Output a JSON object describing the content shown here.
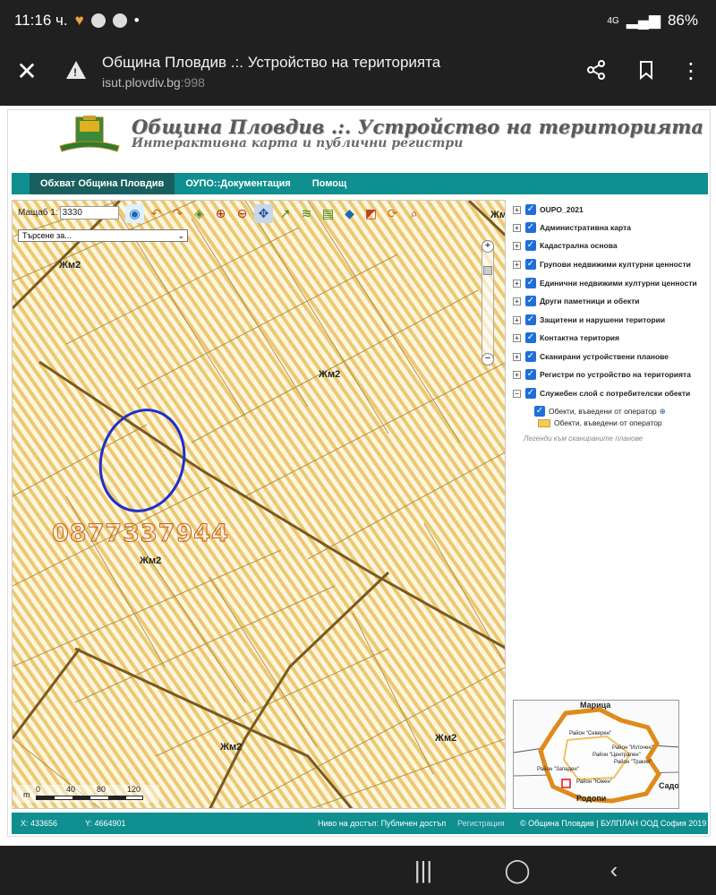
{
  "statusbar": {
    "time": "11:16 ч.",
    "dot": "•",
    "net": "4G",
    "battery": "86%"
  },
  "browser": {
    "title": "Община Пловдив .:. Устройство на територията",
    "url_host": "isut.plovdiv.bg",
    "url_port": ":998"
  },
  "site": {
    "heading": "Община Пловдив .:. Устройство на територията",
    "subheading": "Интерактивна карта и публични регистри"
  },
  "menu": [
    "Обхват Община Пловдив",
    "ОУПО::Документация",
    "Помощ"
  ],
  "map": {
    "scale_label": "Мащаб 1:",
    "scale_value": "3330",
    "search_placeholder": "Търсене за...",
    "labels": [
      "Жм2",
      "Жм2",
      "Жм2",
      "Жм2",
      "Жм2",
      "Жм"
    ],
    "phone_overlay": "0877337944",
    "ruler": {
      "unit": "m",
      "ticks": [
        "0",
        "40",
        "80",
        "120"
      ]
    },
    "tools": [
      "globe-icon",
      "back-icon",
      "forward-icon",
      "layers-icon",
      "zoom-in-icon",
      "zoom-out-icon",
      "pan-icon",
      "measure-icon",
      "draw-icon",
      "print-icon",
      "info-icon",
      "select-icon",
      "refresh-icon",
      "find-icon"
    ]
  },
  "layers": [
    "OUPO_2021",
    "Административна карта",
    "Кадастрална основа",
    "Групови недвижими културни ценности",
    "Единични недвижими културни ценности",
    "Други паметници и обекти",
    "Защитени и нарушени територии",
    "Контактна територия",
    "Сканирани устройствени планове",
    "Регистри по устройство на територията",
    "Служебен слой с потребителски обекти"
  ],
  "sublayer": {
    "checked": "Обекти, въведени от оператор",
    "legend": "Обекти, въведени от оператор",
    "link": "Легенди към сканираните планове"
  },
  "minimap": {
    "labels": [
      "Марица",
      "Район \"Северен\"",
      "Район \"Източен\"",
      "Район \"Централен\"",
      "Район \"Тракия\"",
      "Район \"Западен\"",
      "Район \"Южен\"",
      "Родопи",
      "Садо"
    ]
  },
  "footer": {
    "x": "X: 433656",
    "y": "Y: 4664901",
    "access": "Ниво на достъп: Публичен достъп",
    "register": "Регистрация",
    "copyright": "© Община Пловдив | БУЛПЛАН ООД София 2019"
  },
  "colors": {
    "teal": "#0f8f8f",
    "hatch": "#f0c870"
  }
}
